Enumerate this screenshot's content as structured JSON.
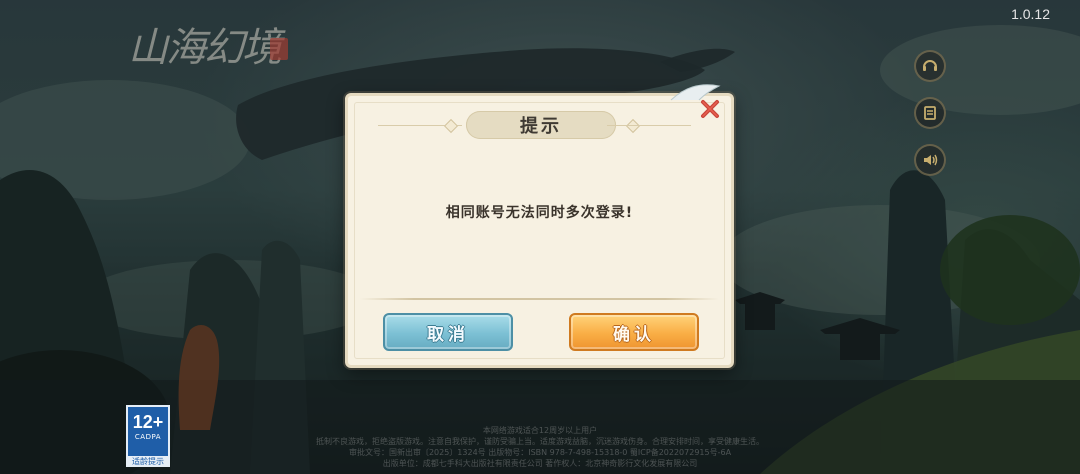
{
  "game": {
    "logo_text": "山海幻境",
    "version": "1.0.12"
  },
  "side_buttons": [
    {
      "icon": "customer-service-icon"
    },
    {
      "icon": "notice-board-icon"
    },
    {
      "icon": "speaker-icon"
    }
  ],
  "age_rating": {
    "age": "12+",
    "org": "CADPA",
    "label": "适龄提示"
  },
  "footer": {
    "line1": "本网络游戏适合12周岁以上用户",
    "line2": "抵制不良游戏，拒绝盗版游戏。注意自我保护，谨防受骗上当。适度游戏益脑，沉迷游戏伤身。合理安排时间，享受健康生活。",
    "line3": "审批文号：国新出审〔2025〕1324号  出版物号：ISBN 978-7-498-15318-0  蜀ICP备2022072915号-6A",
    "line4": "出版单位：成都七手科大出版社有限责任公司  著作权人：北京神奇影行文化发展有限公司"
  },
  "dialog": {
    "title": "提示",
    "message": "相同账号无法同时多次登录!",
    "cancel_label": "取消",
    "confirm_label": "确认",
    "close_icon": "close-icon"
  },
  "colors": {
    "dialog_bg": "#f7f1e2",
    "cancel_button": "#7cc0d4",
    "confirm_button": "#f9ae45",
    "close_icon": "#c9453a"
  }
}
